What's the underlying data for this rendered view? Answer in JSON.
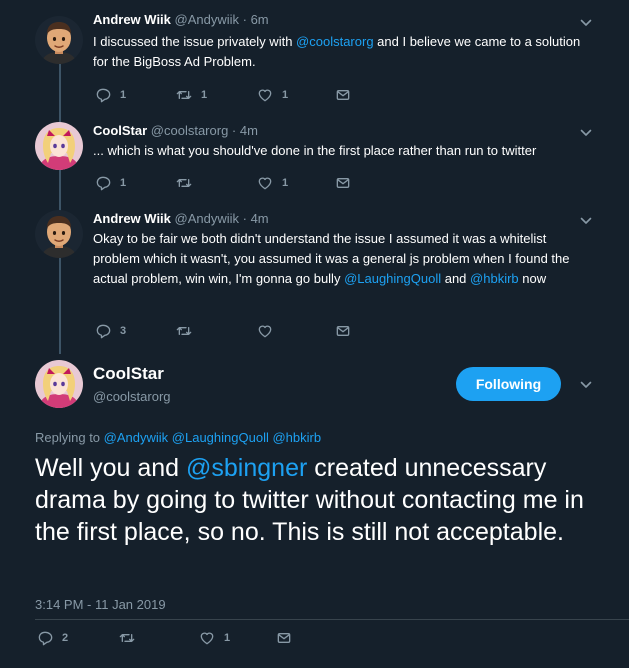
{
  "tweets": [
    {
      "name": "Andrew Wiik",
      "meta": "@Andywiik · 6m",
      "text_pre": "I discussed the issue privately with ",
      "mention": "@coolstarorg",
      "text_post": " and I believe we came to a solution for the BigBoss Ad Problem.",
      "replies": "1",
      "retweets": "1",
      "likes": "1"
    },
    {
      "name": "CoolStar",
      "meta": "@coolstarorg · 4m",
      "text": "... which is what you should've done in the first place rather than run to twitter",
      "replies": "1",
      "retweets": "",
      "likes": "1"
    },
    {
      "name": "Andrew Wiik",
      "meta": "@Andywiik · 4m",
      "text_pre": "Okay to be fair we both didn't understand the issue I assumed it was a whitelist problem which it wasn't, you assumed it was a general js problem when I found the actual problem, win win, I'm gonna go bully ",
      "mention1": "@LaughingQuoll",
      "text_mid": " and ",
      "mention2": "@hbkirb",
      "text_post": " now",
      "replies": "3",
      "retweets": "",
      "likes": ""
    }
  ],
  "main": {
    "name": "CoolStar",
    "handle": "@coolstarorg",
    "follow_label": "Following",
    "replying_label": "Replying to",
    "replying_to": [
      "@Andywiik",
      "@LaughingQuoll",
      "@hbkirb"
    ],
    "text_pre": "Well you and ",
    "mention": "@sbingner",
    "text_post": " created unnecessary drama by going to twitter without contacting me in the first place, so no. This is still not acceptable.",
    "timestamp": "3:14 PM - 11 Jan 2019",
    "replies": "2",
    "retweets": "",
    "likes": "1"
  },
  "icons": [
    "reply-icon",
    "retweet-icon",
    "like-icon",
    "dm-icon",
    "chevron-down-icon"
  ],
  "colors": {
    "background": "#15202b",
    "accent": "#1da1f2",
    "muted": "#8899a6",
    "thread_line": "#3d5466"
  }
}
